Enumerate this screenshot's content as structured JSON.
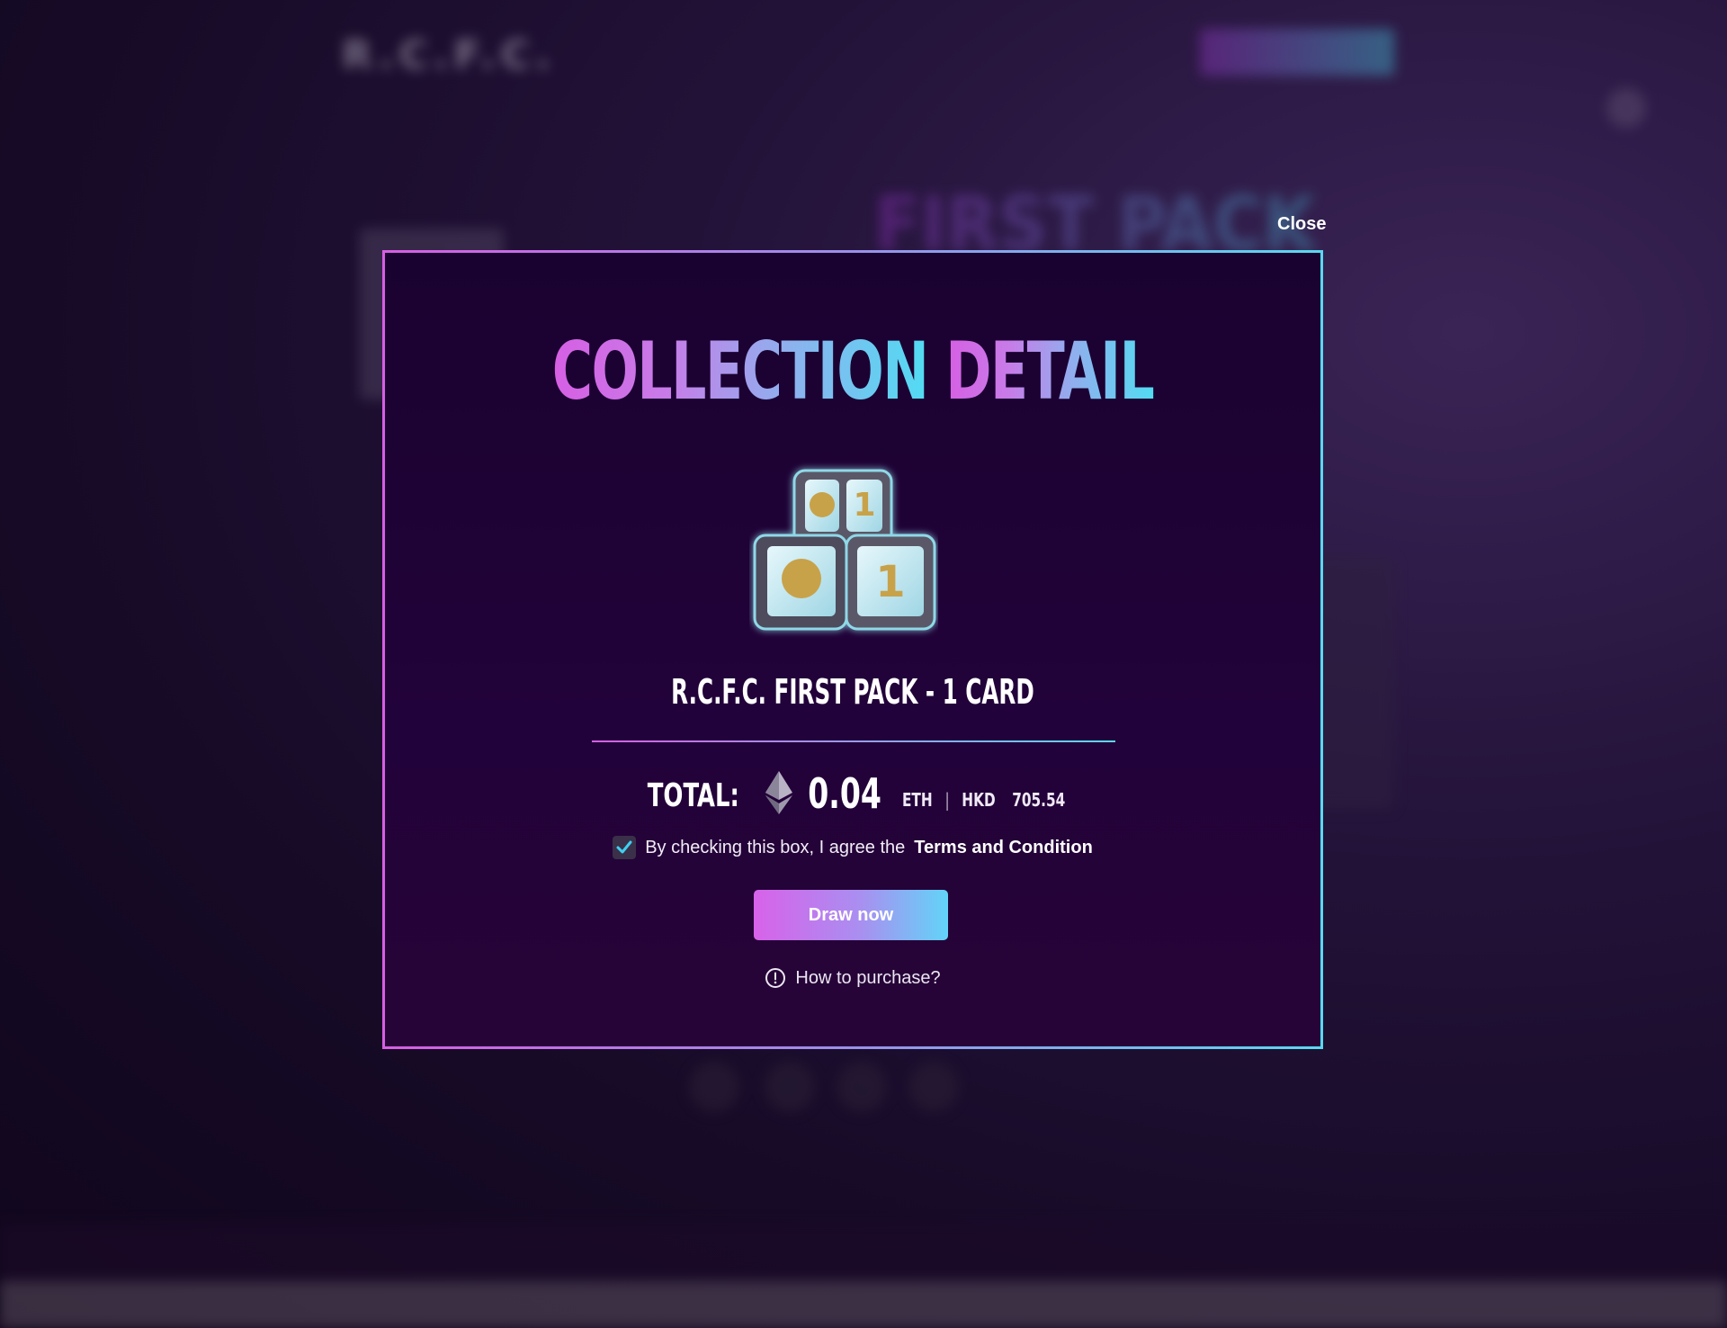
{
  "background_page": {
    "nav_items": [],
    "subtitle": "",
    "title": "FIRST PACK"
  },
  "modal": {
    "close_label": "Close",
    "title_part1": "COLLECTION",
    "title_part2": "DETAIL",
    "item_name": "R.C.F.C. FIRST PACK - 1 CARD",
    "total_label": "TOTAL:",
    "price_eth": "0.04",
    "eth_unit": "ETH",
    "separator": "|",
    "fiat_currency": "HKD",
    "price_fiat": "705.54",
    "agree_checked": true,
    "agree_text": "By checking this box, I agree the",
    "terms_link": "Terms and Condition",
    "draw_button": "Draw now",
    "help_link": "How to purchase?",
    "pack_image": {
      "icon": "rcfc-dice-pack-image",
      "dice_numbers": [
        "1",
        "1"
      ]
    }
  },
  "colors": {
    "accent_pink": "#d65fe3",
    "accent_cyan": "#5ad8f0",
    "modal_bg": "#1a0230",
    "checkbox_tick": "#3fd0ef"
  }
}
